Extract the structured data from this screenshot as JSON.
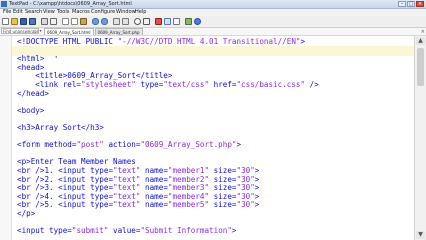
{
  "window": {
    "title": "TextPad - C:\\xampp\\htdocs\\0609_Array_Sort.html"
  },
  "menu": [
    "File",
    "Edit",
    "Search",
    "View",
    "Tools",
    "Macros",
    "Configure",
    "Window",
    "Help"
  ],
  "clip_library": {
    "value": "Find unanswerable"
  },
  "tabs": [
    "0609_Array_Sort.html",
    "0609_Array_Sort.php"
  ],
  "editor": {
    "lines": [
      [
        {
          "t": "<!DOCTYPE HTML PUBLIC ",
          "c": "blue"
        },
        {
          "t": "\"-//W3C//DTD HTML 4.01 Transitional//EN\"",
          "c": "str"
        },
        {
          "t": ">",
          "c": "blue"
        }
      ],
      [],
      [
        {
          "t": "<html>",
          "c": "blue"
        }
      ],
      [
        {
          "t": "<head>",
          "c": "blue"
        }
      ],
      [
        {
          "t": "    <title>",
          "c": "blue"
        },
        {
          "t": "0609_Array_Sort",
          "c": "plain"
        },
        {
          "t": "</title>",
          "c": "blue"
        }
      ],
      [
        {
          "t": "    <link rel=",
          "c": "blue"
        },
        {
          "t": "\"stylesheet\"",
          "c": "str"
        },
        {
          "t": " type=",
          "c": "blue"
        },
        {
          "t": "\"text/css\"",
          "c": "str"
        },
        {
          "t": " href=",
          "c": "blue"
        },
        {
          "t": "\"css/basic.css\"",
          "c": "str"
        },
        {
          "t": " />",
          "c": "blue"
        }
      ],
      [
        {
          "t": "</head>",
          "c": "blue"
        }
      ],
      [],
      [
        {
          "t": "<body>",
          "c": "blue"
        }
      ],
      [],
      [
        {
          "t": "<h3>",
          "c": "blue"
        },
        {
          "t": "Array Sort",
          "c": "plain"
        },
        {
          "t": "</h3>",
          "c": "blue"
        }
      ],
      [],
      [
        {
          "t": "<form method=",
          "c": "blue"
        },
        {
          "t": "\"post\"",
          "c": "str"
        },
        {
          "t": " action=",
          "c": "blue"
        },
        {
          "t": "\"0609_Array_Sort.php\"",
          "c": "str"
        },
        {
          "t": ">",
          "c": "blue"
        }
      ],
      [],
      [
        {
          "t": "<p>",
          "c": "blue"
        },
        {
          "t": "Enter Team Member Names",
          "c": "plain"
        }
      ],
      [
        {
          "t": "<br />",
          "c": "blue"
        },
        {
          "t": "1. ",
          "c": "plain"
        },
        {
          "t": "<input type=",
          "c": "blue"
        },
        {
          "t": "\"text\"",
          "c": "str"
        },
        {
          "t": " name=",
          "c": "blue"
        },
        {
          "t": "\"member1\"",
          "c": "str"
        },
        {
          "t": " size=",
          "c": "blue"
        },
        {
          "t": "\"30\"",
          "c": "str"
        },
        {
          "t": ">",
          "c": "blue"
        }
      ],
      [
        {
          "t": "<br />",
          "c": "blue"
        },
        {
          "t": "2. ",
          "c": "plain"
        },
        {
          "t": "<input type=",
          "c": "blue"
        },
        {
          "t": "\"text\"",
          "c": "str"
        },
        {
          "t": " name=",
          "c": "blue"
        },
        {
          "t": "\"member2\"",
          "c": "str"
        },
        {
          "t": " size=",
          "c": "blue"
        },
        {
          "t": "\"30\"",
          "c": "str"
        },
        {
          "t": ">",
          "c": "blue"
        }
      ],
      [
        {
          "t": "<br />",
          "c": "blue"
        },
        {
          "t": "3. ",
          "c": "plain"
        },
        {
          "t": "<input type=",
          "c": "blue"
        },
        {
          "t": "\"text\"",
          "c": "str"
        },
        {
          "t": " name=",
          "c": "blue"
        },
        {
          "t": "\"member3\"",
          "c": "str"
        },
        {
          "t": " size=",
          "c": "blue"
        },
        {
          "t": "\"30\"",
          "c": "str"
        },
        {
          "t": ">",
          "c": "blue"
        }
      ],
      [
        {
          "t": "<br />",
          "c": "blue"
        },
        {
          "t": "4. ",
          "c": "plain"
        },
        {
          "t": "<input type=",
          "c": "blue"
        },
        {
          "t": "\"text\"",
          "c": "str"
        },
        {
          "t": " name=",
          "c": "blue"
        },
        {
          "t": "\"member4\"",
          "c": "str"
        },
        {
          "t": " size=",
          "c": "blue"
        },
        {
          "t": "\"30\"",
          "c": "str"
        },
        {
          "t": ">",
          "c": "blue"
        }
      ],
      [
        {
          "t": "<br />",
          "c": "blue"
        },
        {
          "t": "5. ",
          "c": "plain"
        },
        {
          "t": "<input type=",
          "c": "blue"
        },
        {
          "t": "\"text\"",
          "c": "str"
        },
        {
          "t": " name=",
          "c": "blue"
        },
        {
          "t": "\"member5\"",
          "c": "str"
        },
        {
          "t": " size=",
          "c": "blue"
        },
        {
          "t": "\"30\"",
          "c": "str"
        },
        {
          "t": ">",
          "c": "blue"
        }
      ],
      [
        {
          "t": "</p>",
          "c": "blue"
        }
      ],
      [],
      [
        {
          "t": "<input type=",
          "c": "blue"
        },
        {
          "t": "\"submit\"",
          "c": "str"
        },
        {
          "t": " value=",
          "c": "blue"
        },
        {
          "t": "\"Submit Information\"",
          "c": "str"
        },
        {
          "t": ">",
          "c": "blue"
        }
      ]
    ]
  },
  "colors": {
    "tag": "#1010d0",
    "string": "#8a2be2",
    "current_line": "#fbf7d6"
  },
  "icons": [
    "new-file-icon",
    "open-folder-icon",
    "save-icon",
    "save-all-icon",
    "print-icon",
    "print-preview-icon",
    "cut-icon",
    "copy-icon",
    "paste-icon",
    "undo-icon",
    "redo-icon",
    "indent-icon",
    "outdent-icon",
    "find-icon",
    "replace-icon",
    "spell-check-icon",
    "word-wrap-icon",
    "visible-spaces-icon",
    "tools-icon",
    "help-icon"
  ]
}
